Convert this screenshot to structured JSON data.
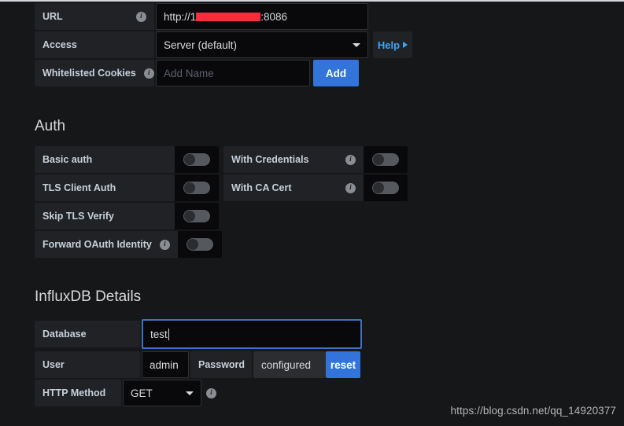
{
  "page": {
    "background": "#161719",
    "accent_blue": "#3274d9",
    "link_blue": "#3ea6f2",
    "redaction_color": "#fa2b3c",
    "focus_border": "#3d71c9"
  },
  "connection": {
    "url": {
      "label": "URL",
      "info_icon": "info-icon",
      "value_prefix": "http://1",
      "value_redacted": true,
      "value_suffix": ":8086"
    },
    "access": {
      "label": "Access",
      "value": "Server (default)",
      "caret_icon": "chevron-down-icon",
      "help_label": "Help",
      "help_caret_icon": "chevron-right-icon"
    },
    "cookies": {
      "label": "Whitelisted Cookies",
      "info_icon": "info-icon",
      "placeholder": "Add Name",
      "value": "",
      "add_label": "Add"
    }
  },
  "auth": {
    "title": "Auth",
    "rows": [
      {
        "left": {
          "label": "Basic auth",
          "has_info": false,
          "toggle": "off"
        },
        "right": {
          "label": "With Credentials",
          "has_info": true,
          "toggle": "off"
        }
      },
      {
        "left": {
          "label": "TLS Client Auth",
          "has_info": false,
          "toggle": "off"
        },
        "right": {
          "label": "With CA Cert",
          "has_info": true,
          "toggle": "off"
        }
      },
      {
        "left": {
          "label": "Skip TLS Verify",
          "has_info": false,
          "toggle": "off"
        },
        "right": null
      },
      {
        "left": {
          "label": "Forward OAuth Identity",
          "has_info": true,
          "toggle": "off"
        },
        "right": null
      }
    ]
  },
  "influx": {
    "title": "InfluxDB Details",
    "database": {
      "label": "Database",
      "value": "test",
      "focused": true
    },
    "user": {
      "label": "User",
      "value": "admin",
      "password_label": "Password",
      "password_state": "configured",
      "reset_label": "reset"
    },
    "http_method": {
      "label": "HTTP Method",
      "value": "GET",
      "caret_icon": "chevron-down-icon",
      "info_icon": "info-icon"
    }
  },
  "watermark": {
    "text": "https://blog.csdn.net/qq_14920377"
  }
}
